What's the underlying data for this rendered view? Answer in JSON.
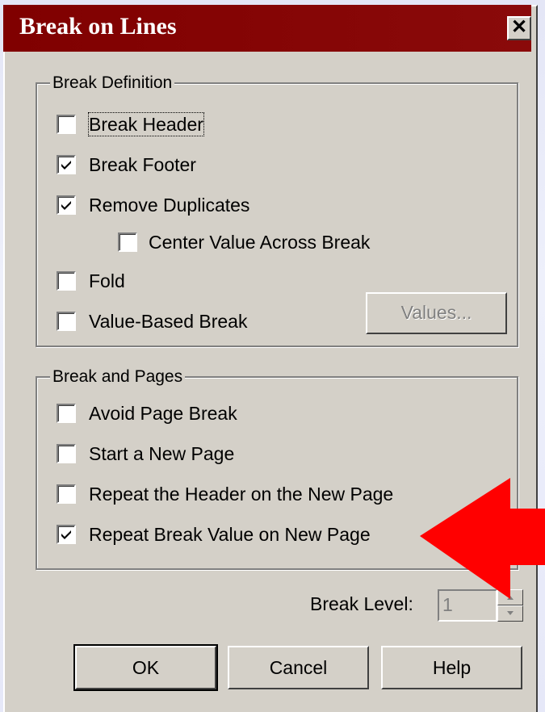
{
  "dialog": {
    "title": "Break on Lines",
    "close_glyph": "✕"
  },
  "break_definition": {
    "legend": "Break Definition",
    "items": [
      {
        "label": "Break Header",
        "checked": false
      },
      {
        "label": "Break Footer",
        "checked": true
      },
      {
        "label": "Remove Duplicates",
        "checked": true
      },
      {
        "label": "Center Value Across Break",
        "checked": false
      },
      {
        "label": "Fold",
        "checked": false
      },
      {
        "label": "Value-Based Break",
        "checked": false
      }
    ],
    "values_button": "Values..."
  },
  "break_pages": {
    "legend": "Break and Pages",
    "items": [
      {
        "label": "Avoid Page Break",
        "checked": false
      },
      {
        "label": "Start a New Page",
        "checked": false
      },
      {
        "label": "Repeat the Header on the New Page",
        "checked": false
      },
      {
        "label": "Repeat Break Value on New Page",
        "checked": true
      }
    ]
  },
  "break_level": {
    "label": "Break Level:",
    "value": "1"
  },
  "buttons": {
    "ok": "OK",
    "cancel": "Cancel",
    "help": "Help"
  },
  "colors": {
    "titlebar": "#800000",
    "dialog_face": "#d4d0c8",
    "annotation_arrow": "#ff0000"
  },
  "icons": {
    "close": "close-icon",
    "check": "checkmark-icon",
    "annotation": "red-arrow-icon"
  }
}
